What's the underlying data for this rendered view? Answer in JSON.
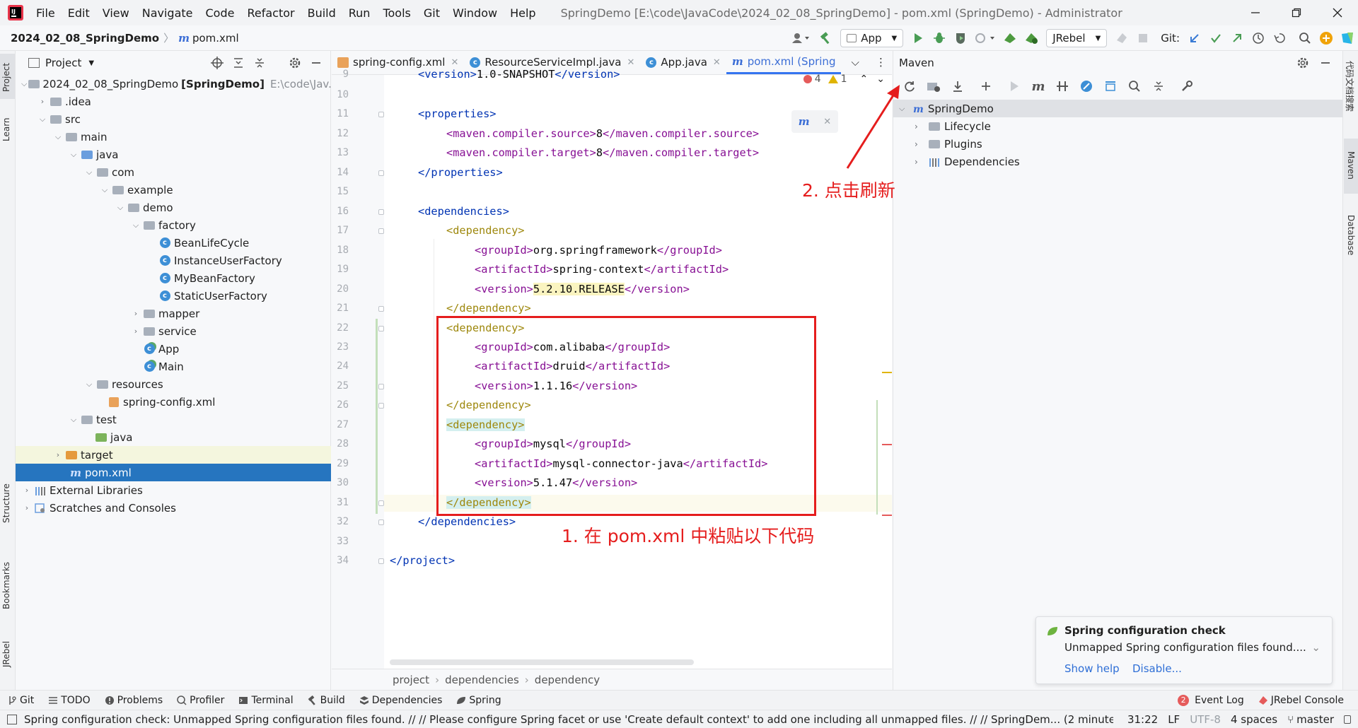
{
  "window": {
    "title": "SpringDemo [E:\\code\\JavaCode\\2024_02_08_SpringDemo] - pom.xml (SpringDemo) - Administrator",
    "menu": [
      "File",
      "Edit",
      "View",
      "Navigate",
      "Code",
      "Refactor",
      "Build",
      "Run",
      "Tools",
      "Git",
      "Window",
      "Help"
    ]
  },
  "navbar": {
    "project": "2024_02_08_SpringDemo",
    "file": "pom.xml",
    "run_config": "App",
    "jrebel": "JRebel",
    "git_label": "Git:"
  },
  "sidebar_left": [
    "Project",
    "Learn",
    "Structure",
    "Bookmarks",
    "JRebel"
  ],
  "sidebar_right": [
    "代码文档搜索",
    "Maven",
    "Database"
  ],
  "project_panel": {
    "title": "Project",
    "tree": [
      {
        "label": "2024_02_08_SpringDemo",
        "bold": "[SpringDemo]",
        "path": "E:\\code\\Jav..."
      },
      {
        "label": ".idea"
      },
      {
        "label": "src"
      },
      {
        "label": "main"
      },
      {
        "label": "java"
      },
      {
        "label": "com"
      },
      {
        "label": "example"
      },
      {
        "label": "demo"
      },
      {
        "label": "factory"
      },
      {
        "label": "BeanLifeCycle"
      },
      {
        "label": "InstanceUserFactory"
      },
      {
        "label": "MyBeanFactory"
      },
      {
        "label": "StaticUserFactory"
      },
      {
        "label": "mapper"
      },
      {
        "label": "service"
      },
      {
        "label": "App"
      },
      {
        "label": "Main"
      },
      {
        "label": "resources"
      },
      {
        "label": "spring-config.xml"
      },
      {
        "label": "test"
      },
      {
        "label": "java"
      },
      {
        "label": "target"
      },
      {
        "label": "pom.xml"
      },
      {
        "label": "External Libraries"
      },
      {
        "label": "Scratches and Consoles"
      }
    ]
  },
  "tabs": [
    {
      "label": "spring-config.xml"
    },
    {
      "label": "ResourceServiceImpl.java"
    },
    {
      "label": "App.java"
    },
    {
      "label": "pom.xml (Spring"
    }
  ],
  "editor": {
    "inspections": {
      "errors": "4",
      "warnings": "1"
    },
    "line_numbers": [
      "9",
      "10",
      "11",
      "12",
      "13",
      "14",
      "15",
      "16",
      "17",
      "18",
      "19",
      "20",
      "21",
      "22",
      "23",
      "24",
      "25",
      "26",
      "27",
      "28",
      "29",
      "30",
      "31",
      "32",
      "33",
      "34"
    ],
    "lines": {
      "l9": {
        "open": "<version>",
        "val": "1.0-SNAPSHOT",
        "close": "</version>"
      },
      "l11": {
        "tag": "<properties>"
      },
      "l12": {
        "open": "<maven.compiler.source>",
        "val": "8",
        "close": "</maven.compiler.source>"
      },
      "l13": {
        "open": "<maven.compiler.target>",
        "val": "8",
        "close": "</maven.compiler.target>"
      },
      "l14": {
        "tag": "</properties>"
      },
      "l16": {
        "tag": "<dependencies>"
      },
      "l17": {
        "tag": "<dependency>"
      },
      "l18": {
        "open": "<groupId>",
        "val": "org.springframework",
        "close": "</groupId>"
      },
      "l19": {
        "open": "<artifactId>",
        "val": "spring-context",
        "close": "</artifactId>"
      },
      "l20": {
        "open": "<version>",
        "val": "5.2.10.RELEASE",
        "close": "</version>"
      },
      "l21": {
        "tag": "</dependency>"
      },
      "l22": {
        "tag": "<dependency>"
      },
      "l23": {
        "open": "<groupId>",
        "val": "com.alibaba",
        "close": "</groupId>"
      },
      "l24": {
        "open": "<artifactId>",
        "val": "druid",
        "close": "</artifactId>"
      },
      "l25": {
        "open": "<version>",
        "val": "1.1.16",
        "close": "</version>"
      },
      "l26": {
        "tag": "</dependency>"
      },
      "l27": {
        "tag": "<dependency>"
      },
      "l28": {
        "open": "<groupId>",
        "val": "mysql",
        "close": "</groupId>"
      },
      "l29": {
        "open": "<artifactId>",
        "val": "mysql-connector-java",
        "close": "</artifactId>"
      },
      "l30": {
        "open": "<version>",
        "val": "5.1.47",
        "close": "</version>"
      },
      "l31": {
        "tag": "</dependency>"
      },
      "l32": {
        "tag": "</dependencies>"
      },
      "l34": {
        "tag": "</project>"
      }
    },
    "annotation_paste": "1. 在 pom.xml 中粘贴以下代码",
    "annotation_refresh": "2. 点击刷新",
    "breadcrumbs": [
      "project",
      "dependencies",
      "dependency"
    ]
  },
  "maven_panel": {
    "title": "Maven",
    "tree": [
      {
        "label": "SpringDemo"
      },
      {
        "label": "Lifecycle"
      },
      {
        "label": "Plugins"
      },
      {
        "label": "Dependencies"
      }
    ]
  },
  "notification": {
    "title": "Spring configuration check",
    "body": "Unmapped Spring configuration files found....",
    "action_help": "Show help",
    "action_disable": "Disable..."
  },
  "bottom_tools": [
    "Git",
    "TODO",
    "Problems",
    "Profiler",
    "Terminal",
    "Build",
    "Dependencies",
    "Spring"
  ],
  "bottom_right": {
    "event_count": "2",
    "event_log": "Event Log",
    "jrebel_console": "JRebel Console"
  },
  "status": {
    "message": "Spring configuration check: Unmapped Spring configuration files found. // // Please configure Spring facet or use 'Create default context' to add one including all unmapped files. // // SpringDem... (2 minutes a",
    "position": "31:22",
    "line_sep": "LF",
    "encoding": "UTF-8",
    "indent": "4 spaces",
    "branch": "master"
  },
  "colors": {
    "accent": "#3574f0",
    "selection": "#2675bf",
    "annotation": "#e51d1d",
    "xml_tag": "#0033b3",
    "xml_value": "#080808"
  }
}
